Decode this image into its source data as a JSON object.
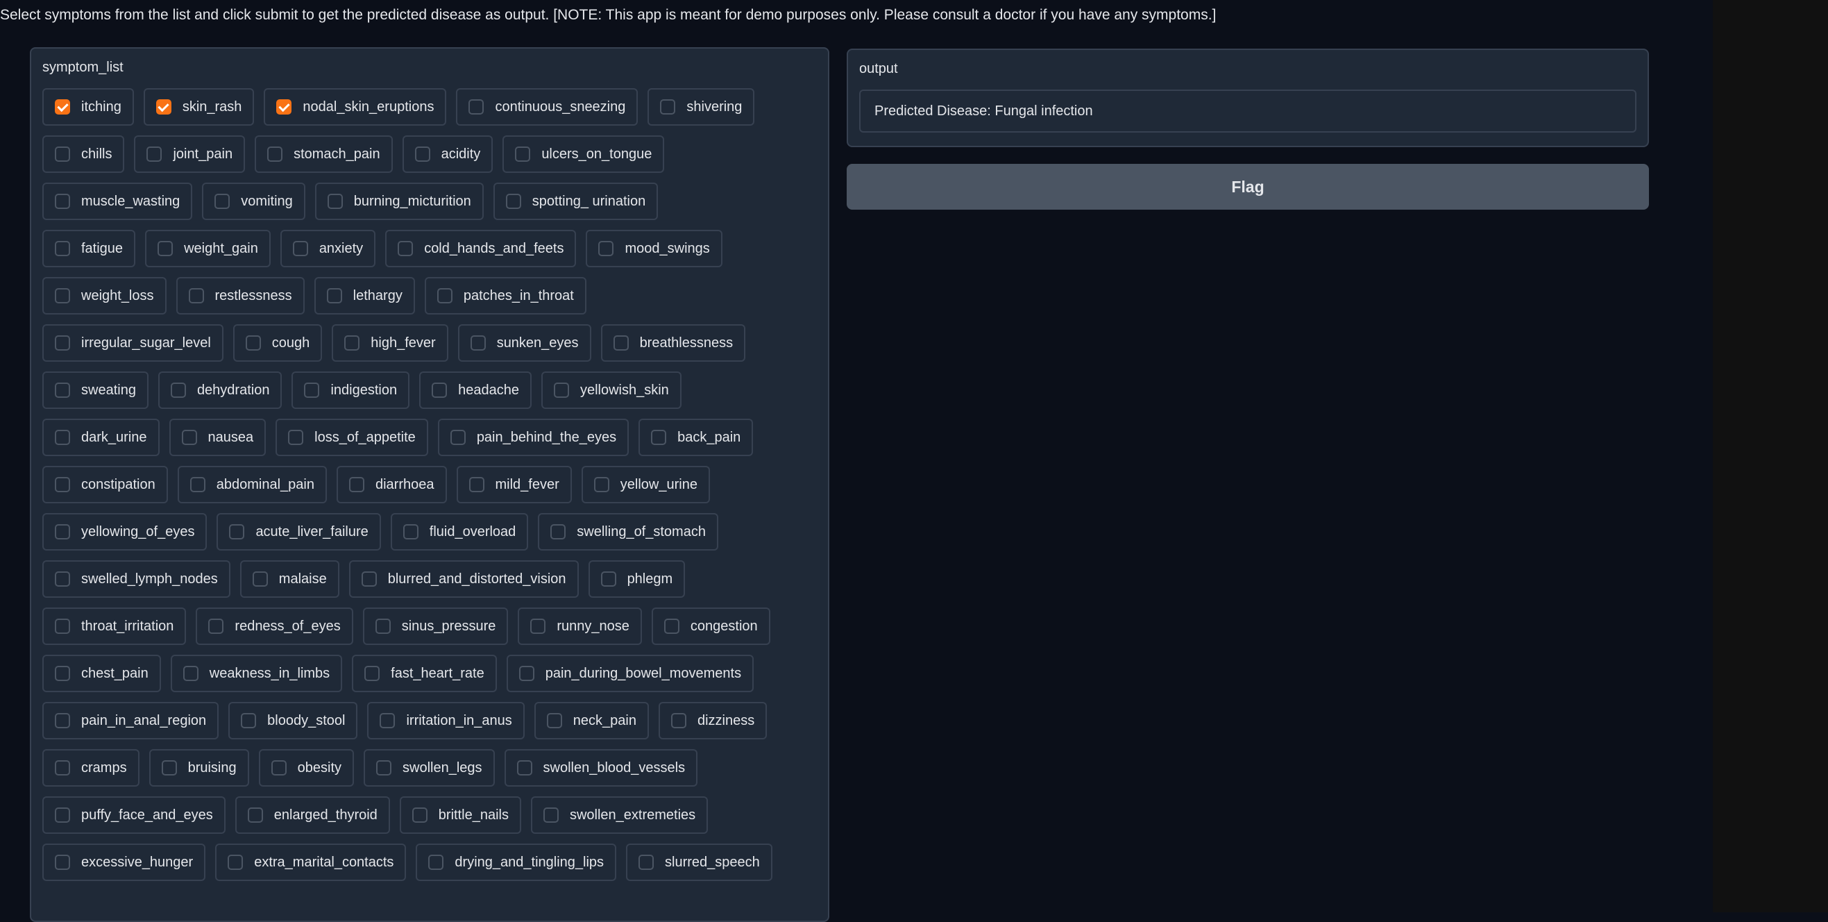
{
  "description": "Select symptoms from the list and click submit to get the predicted disease as output. [NOTE: This app is meant for demo purposes only. Please consult a doctor if you have any symptoms.]",
  "symptom_panel": {
    "label": "symptom_list",
    "rows": [
      [
        {
          "label": "itching",
          "checked": true
        },
        {
          "label": "skin_rash",
          "checked": true
        },
        {
          "label": "nodal_skin_eruptions",
          "checked": true
        },
        {
          "label": "continuous_sneezing",
          "checked": false
        },
        {
          "label": "shivering",
          "checked": false
        }
      ],
      [
        {
          "label": "chills",
          "checked": false
        },
        {
          "label": "joint_pain",
          "checked": false
        },
        {
          "label": "stomach_pain",
          "checked": false
        },
        {
          "label": "acidity",
          "checked": false
        },
        {
          "label": "ulcers_on_tongue",
          "checked": false
        }
      ],
      [
        {
          "label": "muscle_wasting",
          "checked": false
        },
        {
          "label": "vomiting",
          "checked": false
        },
        {
          "label": "burning_micturition",
          "checked": false
        },
        {
          "label": "spotting_ urination",
          "checked": false
        }
      ],
      [
        {
          "label": "fatigue",
          "checked": false
        },
        {
          "label": "weight_gain",
          "checked": false
        },
        {
          "label": "anxiety",
          "checked": false
        },
        {
          "label": "cold_hands_and_feets",
          "checked": false
        },
        {
          "label": "mood_swings",
          "checked": false
        }
      ],
      [
        {
          "label": "weight_loss",
          "checked": false
        },
        {
          "label": "restlessness",
          "checked": false
        },
        {
          "label": "lethargy",
          "checked": false
        },
        {
          "label": "patches_in_throat",
          "checked": false
        }
      ],
      [
        {
          "label": "irregular_sugar_level",
          "checked": false
        },
        {
          "label": "cough",
          "checked": false
        },
        {
          "label": "high_fever",
          "checked": false
        },
        {
          "label": "sunken_eyes",
          "checked": false
        },
        {
          "label": "breathlessness",
          "checked": false
        }
      ],
      [
        {
          "label": "sweating",
          "checked": false
        },
        {
          "label": "dehydration",
          "checked": false
        },
        {
          "label": "indigestion",
          "checked": false
        },
        {
          "label": "headache",
          "checked": false
        },
        {
          "label": "yellowish_skin",
          "checked": false
        }
      ],
      [
        {
          "label": "dark_urine",
          "checked": false
        },
        {
          "label": "nausea",
          "checked": false
        },
        {
          "label": "loss_of_appetite",
          "checked": false
        },
        {
          "label": "pain_behind_the_eyes",
          "checked": false
        },
        {
          "label": "back_pain",
          "checked": false
        }
      ],
      [
        {
          "label": "constipation",
          "checked": false
        },
        {
          "label": "abdominal_pain",
          "checked": false
        },
        {
          "label": "diarrhoea",
          "checked": false
        },
        {
          "label": "mild_fever",
          "checked": false
        },
        {
          "label": "yellow_urine",
          "checked": false
        }
      ],
      [
        {
          "label": "yellowing_of_eyes",
          "checked": false
        },
        {
          "label": "acute_liver_failure",
          "checked": false
        },
        {
          "label": "fluid_overload",
          "checked": false
        },
        {
          "label": "swelling_of_stomach",
          "checked": false
        }
      ],
      [
        {
          "label": "swelled_lymph_nodes",
          "checked": false
        },
        {
          "label": "malaise",
          "checked": false
        },
        {
          "label": "blurred_and_distorted_vision",
          "checked": false
        },
        {
          "label": "phlegm",
          "checked": false
        }
      ],
      [
        {
          "label": "throat_irritation",
          "checked": false
        },
        {
          "label": "redness_of_eyes",
          "checked": false
        },
        {
          "label": "sinus_pressure",
          "checked": false
        },
        {
          "label": "runny_nose",
          "checked": false
        },
        {
          "label": "congestion",
          "checked": false
        }
      ],
      [
        {
          "label": "chest_pain",
          "checked": false
        },
        {
          "label": "weakness_in_limbs",
          "checked": false
        },
        {
          "label": "fast_heart_rate",
          "checked": false
        },
        {
          "label": "pain_during_bowel_movements",
          "checked": false
        }
      ],
      [
        {
          "label": "pain_in_anal_region",
          "checked": false
        },
        {
          "label": "bloody_stool",
          "checked": false
        },
        {
          "label": "irritation_in_anus",
          "checked": false
        },
        {
          "label": "neck_pain",
          "checked": false
        },
        {
          "label": "dizziness",
          "checked": false
        }
      ],
      [
        {
          "label": "cramps",
          "checked": false
        },
        {
          "label": "bruising",
          "checked": false
        },
        {
          "label": "obesity",
          "checked": false
        },
        {
          "label": "swollen_legs",
          "checked": false
        },
        {
          "label": "swollen_blood_vessels",
          "checked": false
        }
      ],
      [
        {
          "label": "puffy_face_and_eyes",
          "checked": false
        },
        {
          "label": "enlarged_thyroid",
          "checked": false
        },
        {
          "label": "brittle_nails",
          "checked": false
        },
        {
          "label": "swollen_extremeties",
          "checked": false
        }
      ],
      [
        {
          "label": "excessive_hunger",
          "checked": false
        },
        {
          "label": "extra_marital_contacts",
          "checked": false
        },
        {
          "label": "drying_and_tingling_lips",
          "checked": false
        },
        {
          "label": "slurred_speech",
          "checked": false
        }
      ]
    ]
  },
  "output_panel": {
    "label": "output",
    "value": "Predicted Disease: Fungal infection"
  },
  "flag_button": {
    "label": "Flag"
  }
}
